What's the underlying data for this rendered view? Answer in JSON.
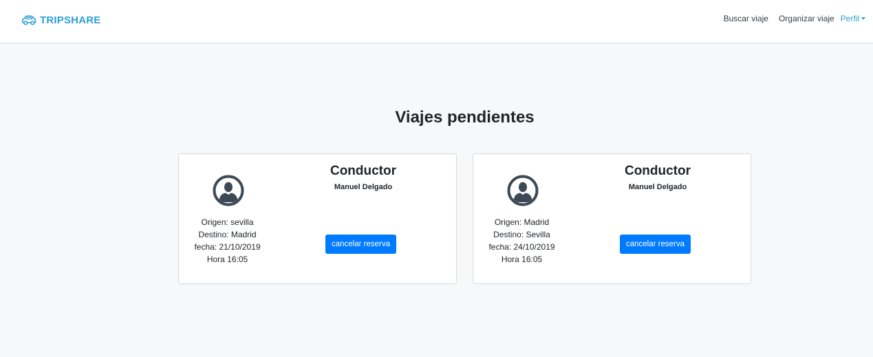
{
  "navbar": {
    "brand": "TRIPSHARE",
    "brand_icon": "car-icon",
    "links": [
      "Buscar viaje",
      "Organizar viaje"
    ],
    "profile": "Perfil"
  },
  "page": {
    "title": "Viajes pendientes"
  },
  "trips": [
    {
      "avatar_icon": "user-circle-icon",
      "origin": "Origen: sevilla",
      "destination": "Destino: Madrid",
      "date": "fecha: 21/10/2019",
      "time": "Hora 16:05",
      "driver_heading": "Conductor",
      "driver_name": "Manuel Delgado",
      "cancel_label": "cancelar reserva"
    },
    {
      "avatar_icon": "user-circle-icon",
      "origin": "Origen: Madrid",
      "destination": "Destino: Sevilla",
      "date": "fecha: 24/10/2019",
      "time": "Hora 16:05",
      "driver_heading": "Conductor",
      "driver_name": "Manuel Delgado",
      "cancel_label": "cancelar reserva"
    }
  ],
  "colors": {
    "brand": "#2a9fd6",
    "primary_button": "#007bff",
    "avatar": "#3d4a55",
    "background": "#f7f8f9"
  }
}
